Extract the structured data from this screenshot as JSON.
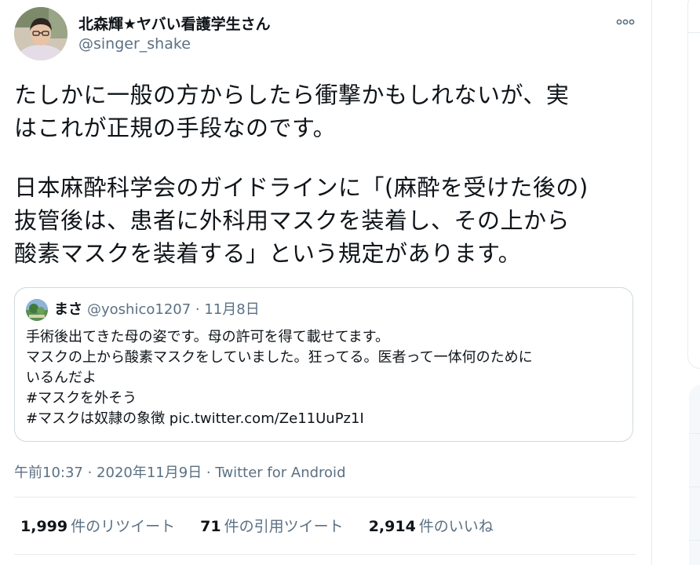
{
  "tweet": {
    "author": {
      "display_name": "北森輝★ヤバい看護学生さん",
      "handle": "@singer_shake"
    },
    "text_lines": [
      "たしかに一般の方からしたら衝撃かもしれないが、実",
      "はこれが正規の手段なのです。",
      "日本麻酔科学会のガイドラインに「(麻酔を受けた後の)",
      "抜管後は、患者に外科用マスクを装着し、その上から",
      "酸素マスクを装着する」という規定があります。"
    ],
    "quoted": {
      "display_name": "まさ",
      "meta": "@yoshico1207 · 11月8日",
      "lines": [
        "手術後出てきた母の姿です。母の許可を得て載せてます。",
        "マスクの上から酸素マスクをしていました。狂ってる。医者って一体何のために",
        "いるんだよ",
        "#マスクを外そう",
        "#マスクは奴隷の象徴 pic.twitter.com/Ze11UuPz1I"
      ]
    },
    "timestamp": "午前10:37 · 2020年11月9日",
    "separator": " · ",
    "source": "Twitter for Android",
    "stats": {
      "retweets": {
        "count": "1,999",
        "label": "件のリツイート"
      },
      "quotes": {
        "count": "71",
        "label": "件の引用ツイート"
      },
      "likes": {
        "count": "2,914",
        "label": "件のいいね"
      }
    }
  },
  "icons": {
    "more": "more-horizontal-icon"
  },
  "colors": {
    "text_primary": "#0f1419",
    "text_secondary": "#5b7083",
    "border": "#cfd9de",
    "divider": "#e6ecf0"
  }
}
